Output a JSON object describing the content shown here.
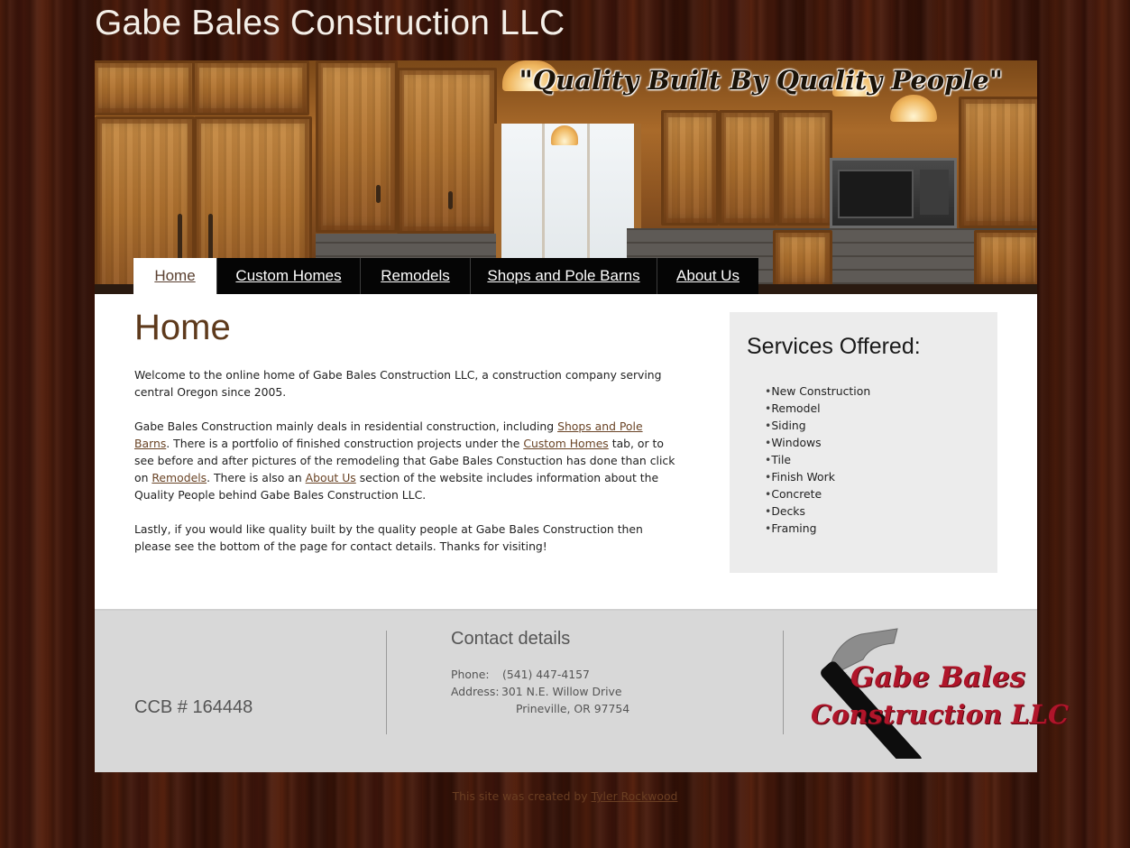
{
  "site": {
    "title": "Gabe Bales Construction LLC",
    "tagline": "\"Quality Built By Quality People\""
  },
  "nav": {
    "items": [
      {
        "label": "Home",
        "active": true
      },
      {
        "label": "Custom Homes",
        "active": false
      },
      {
        "label": "Remodels",
        "active": false
      },
      {
        "label": "Shops and Pole Barns",
        "active": false
      },
      {
        "label": "About Us",
        "active": false
      }
    ]
  },
  "main": {
    "heading": "Home",
    "p1": "Welcome to the online home of Gabe Bales Construction LLC, a construction company serving central Oregon since 2005.",
    "p2": {
      "t1": "Gabe Bales Construction mainly deals in residential construction, including ",
      "link1": "Shops and Pole Barns",
      "t2": ". There is a portfolio of finished construction projects under the ",
      "link2": "Custom Homes",
      "t3": " tab, or to see before and after pictures of the remodeling that Gabe Bales Constuction has done than click on ",
      "link3": "Remodels",
      "t4": ". There is also an ",
      "link4": "About Us",
      "t5": " section of the website includes information about the Quality People behind Gabe Bales Construction LLC."
    },
    "p3": "Lastly, if you would like quality built by the quality people at Gabe Bales Construction then please see the bottom of the page for contact details. Thanks for visiting!"
  },
  "sidebar": {
    "title": "Services Offered:",
    "items": [
      "New Construction",
      "Remodel",
      "Siding",
      "Windows",
      "Tile",
      "Finish Work",
      "Concrete",
      "Decks",
      "Framing"
    ]
  },
  "footer": {
    "ccb": "CCB # 164448",
    "contact_title": "Contact details",
    "phone_label": "Phone:",
    "phone": "(541) 447-4157",
    "address_label": "Address:",
    "address_line1": "301 N.E. Willow Drive",
    "address_line2": "Prineville, OR 97754",
    "logo_line1": "Gabe Bales",
    "logo_line2": "Construction LLC"
  },
  "credit": {
    "text": "This site was created by ",
    "link": "Tyler Rockwood"
  },
  "colors": {
    "heading_brown": "#5e3a1c",
    "link_brown": "#6a4426",
    "logo_red": "#b0152a",
    "nav_bg": "#050505",
    "footer_bg": "#d8d8d8",
    "sidebar_bg": "#ececec"
  }
}
